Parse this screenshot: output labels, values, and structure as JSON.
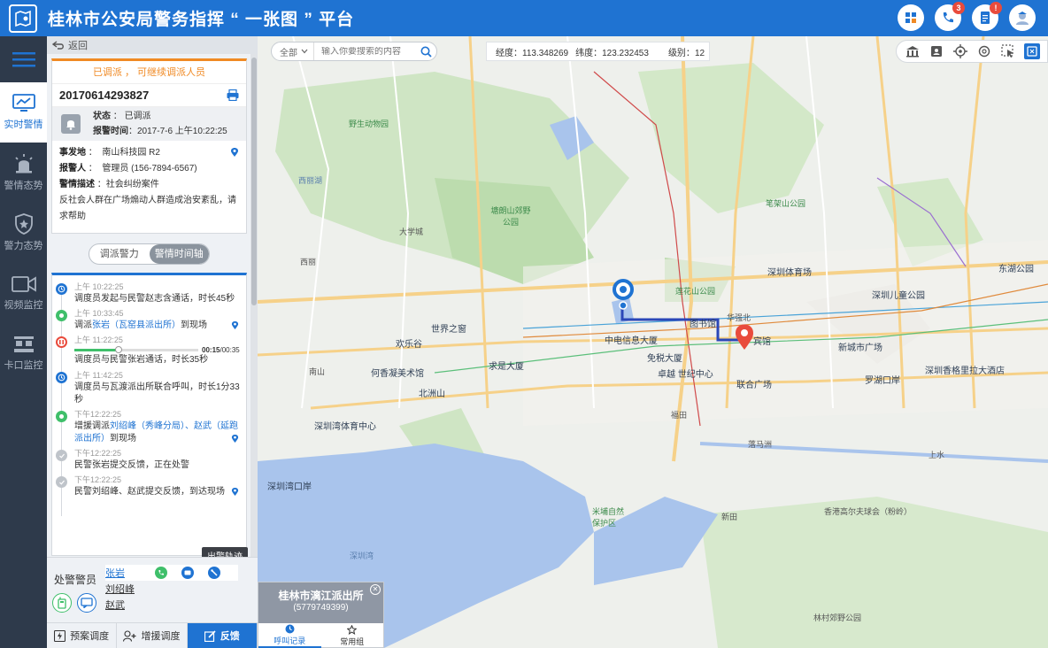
{
  "app": {
    "title": "桂林市公安局警务指挥 “ 一张图 ” 平台"
  },
  "header_icons": [
    {
      "name": "dashboard-icon",
      "badge": ""
    },
    {
      "name": "phone-icon",
      "badge": "3"
    },
    {
      "name": "document-icon",
      "badge": "!"
    },
    {
      "name": "avatar-icon",
      "badge": ""
    }
  ],
  "nav": {
    "items": [
      {
        "label": "实时警情",
        "icon": "monitor-chart-icon",
        "active": true
      },
      {
        "label": "警情态势",
        "icon": "siren-icon"
      },
      {
        "label": "警力态势",
        "icon": "police-shield-icon"
      },
      {
        "label": "视频监控",
        "icon": "video-camera-icon"
      },
      {
        "label": "卡口监控",
        "icon": "checkpoint-icon"
      }
    ]
  },
  "panel": {
    "back_label": "返回",
    "status_banner": "已调派 ， 可继续调派人员",
    "case_id": "20170614293827",
    "status_label": "状态",
    "status_value": "已调派",
    "report_time_label": "报警时间",
    "report_time_value": "2017-7-6  上午10:22:25",
    "location_label": "事发地",
    "location_value": "南山科技园 R2",
    "reporter_label": "报警人",
    "reporter_value": "管理员 (156-7894-6567)",
    "desc_label": "警情描述",
    "desc_value": "社会纠纷案件",
    "detail": "反社会人群在广场煽动人群造成治安紊乱，请求帮助",
    "tabs": [
      "调派警力",
      "警情时间轴"
    ],
    "active_tab": 1,
    "timeline": [
      {
        "time": "上午 10:22:25",
        "text": "调度员发起与民警赵志含通话，时长45秒",
        "type": "blue"
      },
      {
        "time": "上午 10:33:45",
        "text_pre": "调派",
        "link": "张岩（瓦窑县派出所）",
        "text_post": "到现场",
        "type": "green",
        "pin": true
      },
      {
        "time": "上午 11:22:25",
        "text": "调度员与民警张岩通话，时长35秒",
        "type": "red",
        "audio": "00:15/00:35",
        "audio_elapsed": "00:15",
        "audio_total": "00:35",
        "audio_progress_fraction": 0.43
      },
      {
        "time": "上午 11:42:25",
        "text": "调度员与瓦渡派出所联合呼叫，时长1分33秒",
        "type": "blue"
      },
      {
        "time": "下午12:22:25",
        "text_pre": "增援调派",
        "link": "刘绍峰（秀峰分局）、赵武（延跑派出所）",
        "text_post": "到现场",
        "type": "green",
        "pin": true
      },
      {
        "time": "下午12:22:25",
        "text": "民警张岩提交反馈，正在处警",
        "type": "grey"
      },
      {
        "time": "下午12:22:25",
        "text": "民警刘绍峰、赵武提交反馈，到达现场",
        "type": "grey",
        "pin": true
      }
    ],
    "officers_label": "处警警员",
    "officers": [
      "张岩",
      "刘绍峰",
      "赵武"
    ],
    "tooltip": "出警轨迹",
    "bottom_buttons": [
      "预案调度",
      "增援调度",
      "反馈"
    ]
  },
  "map": {
    "search_scope": "全部",
    "search_placeholder": "输入你要搜索的内容",
    "longitude_label": "经度：",
    "longitude": "113.348269",
    "latitude_label": "纬度：",
    "latitude": "123.232453",
    "level_label": "级别：",
    "level": "12",
    "labels": [
      "野生动物园",
      "塘朗山郊野公园",
      "西丽",
      "大学城",
      "南山",
      "西丽湖",
      "莲花山公园",
      "笔架山公园",
      "深圳体育场",
      "深圳儿童公园",
      "东湖公园",
      "新城市广场",
      "中电信息大厦",
      "免税大厦",
      "卓越 世纪中心",
      "联合广场",
      "欢乐谷",
      "何香凝美术馆",
      "北洲山",
      "求是大厦",
      "世界之窗",
      "深圳湾体育中心",
      "深圳湾口岸",
      "福田",
      "华强北",
      "罗湖口岸",
      "深圳香格里拉大酒店",
      "米埔自然保护区",
      "新田",
      "香港高尔夫球会（粉岭）",
      "林村郊野公园",
      "上水",
      "落马洲",
      "深圳湾",
      "宾馆",
      "图书馆"
    ],
    "popup_title": "桂林市漓江派出所",
    "popup_phone": "(5779749399)",
    "popup_tabs": [
      "呼叫记录",
      "常用组"
    ]
  },
  "colors": {
    "primary": "#1f73d2",
    "accent": "#f08a24",
    "danger": "#e94b3c",
    "success": "#3fbf6a",
    "nav_bg": "#2e3a4b"
  }
}
